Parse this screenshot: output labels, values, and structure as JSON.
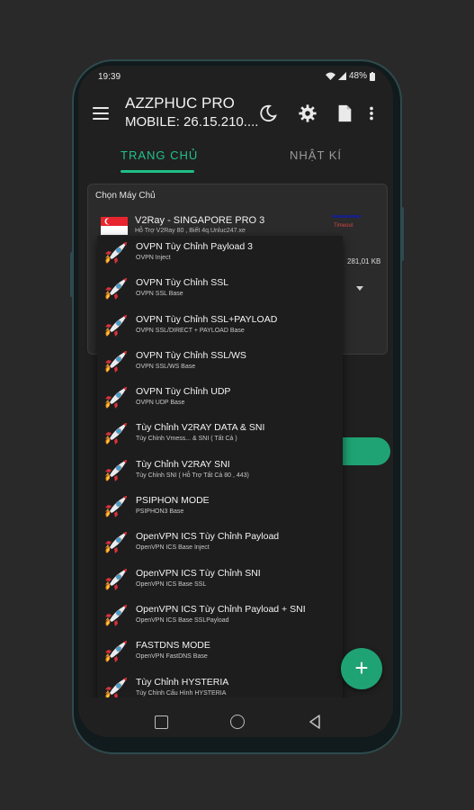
{
  "status": {
    "time": "19:39",
    "battery": "48%"
  },
  "header": {
    "title": "AZZPHUC PRO",
    "subtitle": "MOBILE: 26.15.210...."
  },
  "tabs": [
    {
      "label": "TRANG CHỦ",
      "active": true
    },
    {
      "label": "NHẬT KÍ",
      "active": false
    }
  ],
  "server_card": {
    "label": "Chọn Máy Chủ",
    "selected_title": "V2Ray - SINGAPORE PRO 3",
    "selected_sub": "Hỗ Trợ V2Ray 80 , Biết 4q.Unluc247.xe",
    "badge": "Timeout",
    "traffic": "281,01 KB"
  },
  "server_list": [
    {
      "name": "OVPN Tùy Chỉnh Payload 3",
      "desc": "OVPN Inject"
    },
    {
      "name": "OVPN Tùy Chỉnh SSL",
      "desc": "OVPN SSL Base"
    },
    {
      "name": "OVPN Tùy Chỉnh SSL+PAYLOAD",
      "desc": "OVPN SSL/DIRECT + PAYLOAD Base"
    },
    {
      "name": "OVPN Tùy Chỉnh SSL/WS",
      "desc": "OVPN SSL/WS Base"
    },
    {
      "name": "OVPN Tùy Chỉnh UDP",
      "desc": "OVPN UDP Base"
    },
    {
      "name": "Tùy Chỉnh V2RAY DATA & SNI",
      "desc": "Tùy Chỉnh Vmess... & SNI ( Tất Cả )"
    },
    {
      "name": "Tùy Chỉnh V2RAY SNI",
      "desc": "Tùy Chỉnh SNI ( Hỗ Trợ Tất Cả 80 , 443)"
    },
    {
      "name": "PSIPHON MODE",
      "desc": "PSIPHON3 Base"
    },
    {
      "name": "OpenVPN ICS Tùy Chỉnh Payload",
      "desc": "OpenVPN ICS Base Inject"
    },
    {
      "name": "OpenVPN ICS Tùy Chỉnh SNI",
      "desc": "OpenVPN ICS Base SSL"
    },
    {
      "name": "OpenVPN ICS Tùy Chỉnh Payload + SNI",
      "desc": "OpenVPN ICS Base SSLPayload"
    },
    {
      "name": "FASTDNS MODE",
      "desc": "OpenVPN FastDNS Base"
    },
    {
      "name": "Tùy Chỉnh HYSTERIA",
      "desc": "Tùy Chỉnh Cấu Hình HYSTERIA"
    }
  ],
  "fab": {
    "label": "+"
  },
  "colors": {
    "accent": "#1fbf87",
    "background": "#202020",
    "list_bg": "#1d1d1d"
  },
  "icons": [
    "menu-icon",
    "moon-icon",
    "gear-icon",
    "file-icon",
    "more-vert-icon",
    "rocket-icon",
    "singapore-flag-icon",
    "nav-recents-icon",
    "nav-home-icon",
    "nav-back-icon"
  ]
}
